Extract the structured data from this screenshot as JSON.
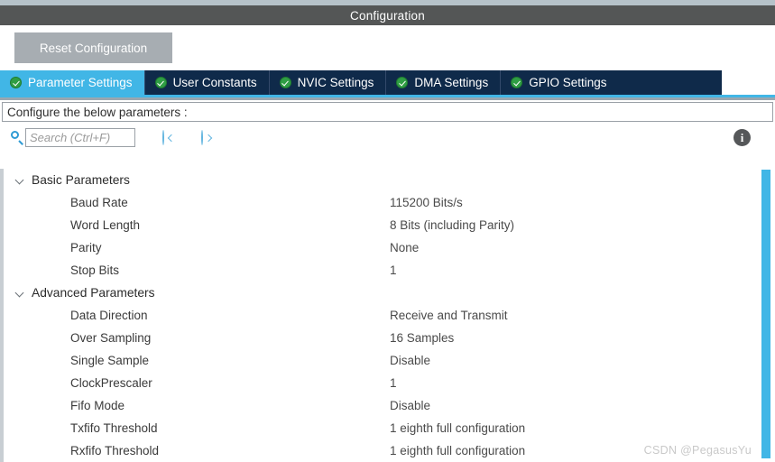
{
  "window": {
    "title": "Configuration"
  },
  "toolbar": {
    "reset_label": "Reset Configuration"
  },
  "tabs": [
    {
      "label": "Parameter Settings",
      "icon": "check-circle-icon",
      "active": true
    },
    {
      "label": "User Constants",
      "icon": "check-circle-icon",
      "active": false
    },
    {
      "label": "NVIC Settings",
      "icon": "check-circle-icon",
      "active": false
    },
    {
      "label": "DMA Settings",
      "icon": "check-circle-icon",
      "active": false
    },
    {
      "label": "GPIO Settings",
      "icon": "check-circle-icon",
      "active": false
    }
  ],
  "configure_bar": {
    "label": "Configure the below parameters :"
  },
  "search": {
    "icon": "search-icon",
    "placeholder": "Search (Ctrl+F)",
    "value": "",
    "prev_icon": "circle-arrow-left-icon",
    "next_icon": "circle-arrow-right-icon"
  },
  "info": {
    "icon": "info-icon",
    "glyph": "i"
  },
  "groups": [
    {
      "label": "Basic Parameters",
      "expanded": true,
      "chevron": "chevron-down-icon",
      "params": [
        {
          "name": "Baud Rate",
          "value": "115200 Bits/s"
        },
        {
          "name": "Word Length",
          "value": "8 Bits (including Parity)"
        },
        {
          "name": "Parity",
          "value": "None"
        },
        {
          "name": "Stop Bits",
          "value": "1"
        }
      ]
    },
    {
      "label": "Advanced Parameters",
      "expanded": true,
      "chevron": "chevron-down-icon",
      "params": [
        {
          "name": "Data Direction",
          "value": "Receive and Transmit"
        },
        {
          "name": "Over Sampling",
          "value": "16 Samples"
        },
        {
          "name": "Single Sample",
          "value": "Disable"
        },
        {
          "name": "ClockPrescaler",
          "value": "1"
        },
        {
          "name": "Fifo Mode",
          "value": "Disable"
        },
        {
          "name": "Txfifo Threshold",
          "value": "1 eighth full configuration"
        },
        {
          "name": "Rxfifo Threshold",
          "value": "1 eighth full configuration"
        }
      ]
    }
  ],
  "watermark": {
    "text": "CSDN @PegasusYu"
  },
  "colors": {
    "accent": "#41b6e6",
    "tabbar": "#0f2a4a",
    "titlebar": "#545656",
    "check": "#2f9e44"
  }
}
